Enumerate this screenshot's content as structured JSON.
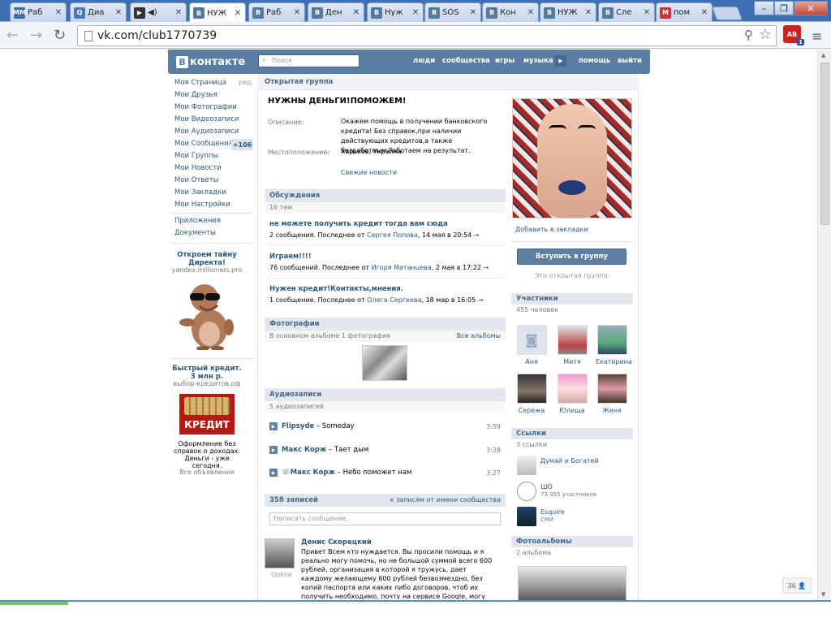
{
  "browser": {
    "tabs": [
      {
        "label": "Раб",
        "fav": "MM",
        "color": "#3b6aa8"
      },
      {
        "label": "Диа",
        "fav": "Q",
        "color": "#4a7ab8"
      },
      {
        "label": "",
        "fav": "▶",
        "color": "#333"
      },
      {
        "label": "НУЖ",
        "fav": "B",
        "color": "#5479a0"
      },
      {
        "label": "Раб",
        "fav": "B",
        "color": "#5479a0"
      },
      {
        "label": "Ден",
        "fav": "B",
        "color": "#5479a0"
      },
      {
        "label": "Нуж",
        "fav": "B",
        "color": "#5479a0"
      },
      {
        "label": "SOS",
        "fav": "B",
        "color": "#5479a0"
      },
      {
        "label": "Кон",
        "fav": "B",
        "color": "#5479a0"
      },
      {
        "label": "НУЖ",
        "fav": "B",
        "color": "#5479a0"
      },
      {
        "label": "Сле",
        "fav": "B",
        "color": "#5479a0"
      },
      {
        "label": "пом",
        "fav": "M",
        "color": "#c33"
      }
    ],
    "url": "vk.com/club1770739",
    "ext_badge": "1",
    "ext_label": "AB"
  },
  "vk": {
    "logo_letter": "В",
    "logo_text": "контакте",
    "search_placeholder": "Поиск",
    "nav": {
      "people": "люди",
      "communities": "сообщества",
      "games": "игры",
      "music": "музыка",
      "help": "помощь",
      "logout": "выйти"
    }
  },
  "left_menu": {
    "edit": "ред.",
    "items": [
      "Моя Страница",
      "Мои Друзья",
      "Мои Фотографии",
      "Мои Видеозаписи",
      "Мои Аудиозаписи",
      "Мои Сообщения",
      "Мои Группы",
      "Мои Новости",
      "Мои Ответы",
      "Мои Закладки",
      "Мои Настройки"
    ],
    "messages_badge": "+106",
    "extra": [
      "Приложения",
      "Документы"
    ],
    "ad1": {
      "title": "Откроем тайну Директа!",
      "domain": "yandex.millioners.pro"
    },
    "ad2": {
      "title": "Быстрый кредит. 3 млн р.",
      "domain": "выбор-кредитов.рф",
      "image_label": "КРЕДИТ",
      "body": "Оформление без справок о доходах. Деньги - уже сегодня."
    },
    "all_ads": "Все объявления"
  },
  "group": {
    "type": "Открытая группа",
    "title": "НУЖНЫ ДЕНЬГИ!ПОМОЖЕМ!",
    "desc_label": "Описание:",
    "desc": "Окажем помощь в получении банковского кредита! Без справок,при наличии действующих кредитов,а также безработным.Работаем на результат.",
    "loc_label": "Местоположение:",
    "loc": "Харьков, Украина",
    "news_link": "Свежие новости"
  },
  "discussions": {
    "header": "Обсуждения",
    "count": "16 тем",
    "topics": [
      {
        "title": "не можете получить кредит тогда вам сюда",
        "meta": "2 сообщения. Последнее от",
        "author": "Сергея Попова",
        "date": ", 14 мая в 20:54"
      },
      {
        "title": "Играем!!!!",
        "meta": "76 сообщений. Последнее от",
        "author": "Игоря Матанцева",
        "date": ", 2 мая в 17:22"
      },
      {
        "title": "Нужен кредит!Контакты,мнения.",
        "meta": "1 сообщение. Последнее от",
        "author": "Олега Сергеева",
        "date": ", 18 мар в 16:05"
      }
    ]
  },
  "photos": {
    "header": "Фотографии",
    "sub": "В основном альбоме 1 фотография",
    "all": "Все альбомы"
  },
  "audio": {
    "header": "Аудиозаписи",
    "sub": "5 аудиозаписей",
    "tracks": [
      {
        "artist": "Flipsyde",
        "title": " – Someday",
        "dur": "3:59"
      },
      {
        "artist": "Макс Корж",
        "title": " – Тает дым",
        "dur": "3:28"
      },
      {
        "artist": "Макс Корж",
        "title": " – Небо поможет нам",
        "dur": "3:27"
      }
    ]
  },
  "wall": {
    "count": "358 записей",
    "by_community": "к записям от имени сообщества",
    "placeholder": "Написать сообщение..",
    "post": {
      "author": "Денис Скорецкий",
      "online": "Online",
      "text": "Привет Всем кто нуждается. Вы просили помощь и я реально могу помочь, но не большой суммой всего 600 рублей, организация в которой я тружусь, дает каждому желающему 600 рублей безвозмездно, без копий паспорта или каких либо договоров, чтоб их получить необходимо, почту на сервисе Google, могу завести сам, если проблемы с интернетом, карту"
    }
  },
  "right": {
    "bookmark": "Добавить в закладки",
    "join": "Вступить в группу",
    "open_note": "Это открытая группа.",
    "members": {
      "header": "Участники",
      "count": "455 человек",
      "list": [
        "Аня",
        "Митя",
        "Екатерина",
        "Серёжа",
        "Юлища",
        "Женя"
      ]
    },
    "links": {
      "header": "Ссылки",
      "count": "3 ссылки",
      "list": [
        {
          "title": "Думай и Богатей",
          "sub": ""
        },
        {
          "title": "ШО",
          "sub": "73 355 участников"
        },
        {
          "title": "Esquire",
          "sub": "СМИ"
        }
      ]
    },
    "albums": {
      "header": "Фотоальбомы",
      "count": "2 альбома"
    }
  },
  "chat": {
    "count": "36"
  }
}
